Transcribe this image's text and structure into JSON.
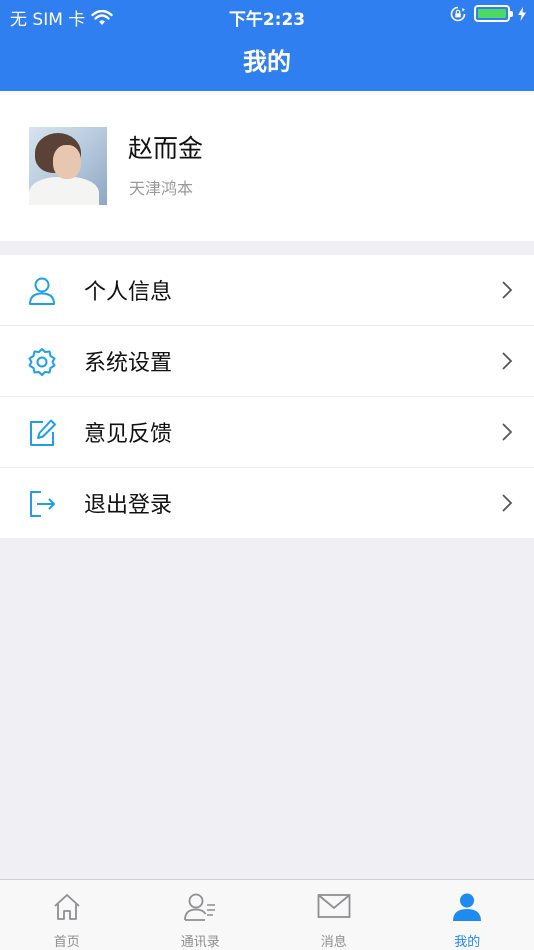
{
  "status_bar": {
    "carrier": "无 SIM 卡",
    "time": "下午2:23"
  },
  "nav": {
    "title": "我的"
  },
  "profile": {
    "name": "赵而金",
    "company": "天津鸿本"
  },
  "menu": [
    {
      "label": "个人信息",
      "icon": "person-icon"
    },
    {
      "label": "系统设置",
      "icon": "gear-icon"
    },
    {
      "label": "意见反馈",
      "icon": "edit-icon"
    },
    {
      "label": "退出登录",
      "icon": "logout-icon"
    }
  ],
  "tabs": [
    {
      "label": "首页",
      "icon": "home-icon",
      "active": false
    },
    {
      "label": "通讯录",
      "icon": "contacts-icon",
      "active": false
    },
    {
      "label": "消息",
      "icon": "mail-icon",
      "active": false
    },
    {
      "label": "我的",
      "icon": "user-icon",
      "active": true
    }
  ],
  "colors": {
    "header": "#2f7ff0",
    "menu_icon": "#1ea0e8",
    "tab_active": "#1e8bf0",
    "tab_inactive": "#8e8e93",
    "battery": "#4cd964"
  }
}
